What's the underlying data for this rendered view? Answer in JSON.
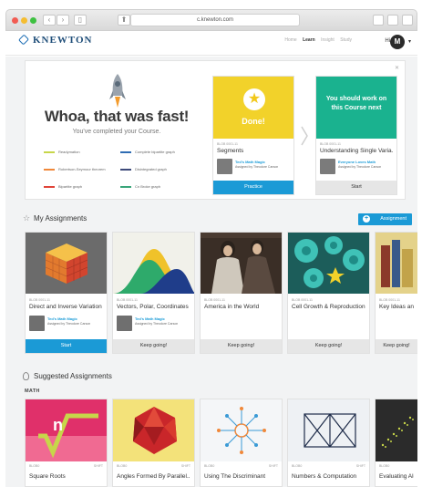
{
  "browser": {
    "url": "c.knewton.com"
  },
  "header": {
    "brand": "KNEWTON",
    "nav": [
      "Home",
      "Learn",
      "Insight",
      "Study"
    ],
    "active_nav": "Learn",
    "greeting": "Hi",
    "avatar_initial": "M"
  },
  "hero": {
    "title": "Whoa, that was fast!",
    "subtitle": "You've completed your Course.",
    "legend": [
      {
        "label": "Readymation",
        "color": "#c7d64a"
      },
      {
        "label": "Complete bipartite graph",
        "color": "#2f6cb3"
      },
      {
        "label": "Robertson-Seymour theorem",
        "color": "#f0883a"
      },
      {
        "label": "Disintegrated graph",
        "color": "#3d4a7a"
      },
      {
        "label": "Bipartite graph",
        "color": "#e0453a"
      },
      {
        "label": "Cn Broke graph",
        "color": "#3aa57a"
      }
    ],
    "tiles": [
      {
        "banner": "Done!",
        "meta": "BLOB 0001-11",
        "name": "Segments",
        "author": "Ted's Math Magic",
        "assigned_by": "Assigned by Theodore Carson",
        "button": "Practice",
        "color": "#f2d22a"
      },
      {
        "banner": "You should work on this Course next",
        "meta": "BLOB 0001-11",
        "name": "Understanding Single Varia...",
        "author": "Everyone Loves Math",
        "assigned_by": "Assigned by Theodore Carson",
        "button": "Start",
        "color": "#1ab28f"
      }
    ]
  },
  "my_assignments": {
    "title": "My Assignments",
    "add_button": "Assignment",
    "cards": [
      {
        "meta": "BLOB 0001-11",
        "name": "Direct and Inverse Variation",
        "author": "Ted's Math Magic",
        "assigned_by": "Assigned by Theodore Carson",
        "button": "Start",
        "button_style": "primary"
      },
      {
        "meta": "BLOB 0001-11",
        "name": "Vectors, Polar, Coordinates",
        "author": "Ted's Math Magic",
        "assigned_by": "Assigned by Theodore Carson",
        "button": "Keep going!",
        "button_style": "grey"
      },
      {
        "meta": "BLOB 0001-11",
        "name": "America in the World",
        "author": "",
        "assigned_by": "",
        "button": "Keep going!",
        "button_style": "grey"
      },
      {
        "meta": "BLOB 0001-11",
        "name": "Cell Growth & Reproduction",
        "author": "",
        "assigned_by": "",
        "button": "Keep going!",
        "button_style": "grey"
      },
      {
        "meta": "BLOB 0001-11",
        "name": "Key Ideas and D",
        "author": "",
        "assigned_by": "",
        "button": "Keep going!",
        "button_style": "grey"
      }
    ]
  },
  "suggested": {
    "title": "Suggested Assignments",
    "category": "MATH",
    "cards": [
      {
        "meta": "BLOB0",
        "meta_right": "SHIFT",
        "name": "Square Roots"
      },
      {
        "meta": "BLOB0",
        "meta_right": "SHIFT",
        "name": "Angles Formed By Parallel..."
      },
      {
        "meta": "BLOB0",
        "meta_right": "SHIFT",
        "name": "Using The Discriminant"
      },
      {
        "meta": "BLOB0",
        "meta_right": "SHIFT",
        "name": "Numbers & Computation"
      },
      {
        "meta": "BLOB0",
        "meta_right": "",
        "name": "Evaluating Algeb"
      }
    ]
  }
}
